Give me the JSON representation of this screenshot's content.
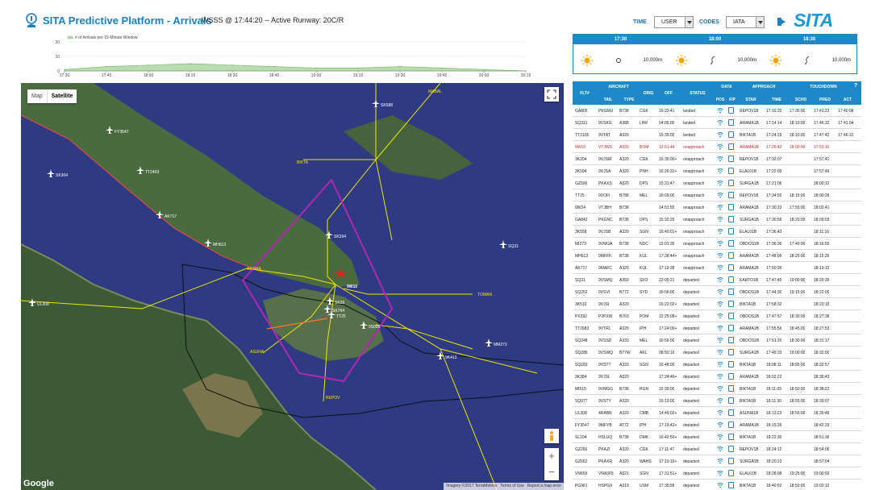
{
  "header": {
    "title": "SITA Predictive Platform - Arrivals",
    "subtitle": "WSSS @ 17:44:20 -- Active Runway: 20C/R",
    "time_label": "TIME",
    "time_value": "USER",
    "codes_label": "CODES",
    "codes_value": "IATA",
    "brand": "SITA"
  },
  "arrivals_chart": {
    "legend": "# of Arrivals per 15-Minute Window",
    "y_ticks": [
      "20",
      "10",
      "0"
    ],
    "x_ticks": [
      "17:30",
      "17:45",
      "18:00",
      "18:15",
      "18:30",
      "18:45",
      "19:00",
      "19:15",
      "19:30",
      "19:45",
      "20:00",
      "20:15"
    ]
  },
  "chart_data": {
    "type": "area",
    "title": "",
    "legend": [
      "# of Arrivals per 15-Minute Window"
    ],
    "x": [
      "17:30",
      "17:45",
      "18:00",
      "18:15",
      "18:30",
      "18:45",
      "19:00",
      "19:15",
      "19:30",
      "19:45",
      "20:00",
      "20:15"
    ],
    "series": [
      {
        "name": "# of Arrivals per 15-Minute Window",
        "values": [
          1,
          3,
          4,
          5,
          4,
          3,
          2,
          2,
          3,
          2,
          1,
          0
        ]
      }
    ],
    "ylim": [
      0,
      20
    ]
  },
  "map": {
    "tab_map": "Map",
    "tab_satellite": "Satellite",
    "attribution": [
      "Imagery ©2017 TerraMetrics",
      "Terms of Use",
      "Report a map error"
    ],
    "google": "Google",
    "fixes": [
      "MABAL",
      "BIKTA",
      "ARAMA",
      "ASUNA",
      "REPOV",
      "TOMAN"
    ],
    "airport": "9W10",
    "planes": [
      "SK588",
      "FY3547",
      "TT2403",
      "SK304",
      "AK717",
      "MH613",
      "SK394",
      "UL308",
      "TT25",
      "SK764",
      "9S056",
      "SQ31",
      "9K413",
      "MM273",
      "SK26"
    ],
    "wind_icons": [
      "sun-icon",
      "calm-icon",
      "windsock-icon"
    ],
    "colors": {
      "ocean": "#2e3a82",
      "land": "#3e5a3a",
      "route": "#f2e600",
      "terminal_area": "#b326b3",
      "border": "#111111"
    }
  },
  "weather": {
    "times": [
      "17:30",
      "18:00",
      "18:30"
    ],
    "visibility": [
      "10,000m",
      "10,000m",
      "10,000m"
    ]
  },
  "table": {
    "group_headers": {
      "aircraft": "AIRCRAFT",
      "data": "DATA",
      "approach": "APPROACH",
      "touchdown": "TOUCHDOWN"
    },
    "columns": [
      "FLT#",
      "TAIL",
      "TYPE",
      "ORIG",
      "OFF",
      "STATUS",
      "POS",
      "F/P",
      "STAR",
      "TIME",
      "SCHD",
      "PRED",
      "ACT"
    ],
    "help": "?",
    "rows": [
      {
        "flt": "GA805",
        "tail": "PKGMU",
        "type": "B738",
        "orig": "CGK",
        "off": "16:23:41",
        "status": "landed",
        "star": "REPOV1B",
        "time": "17:16:29",
        "schd": "17:35:00",
        "pred": "17:41:23",
        "act": "17:40:08"
      },
      {
        "flt": "SQ321",
        "tail": "9VSKG",
        "type": "A388",
        "orig": "LHR",
        "off": "04:05:00",
        "status": "landed",
        "star": "ARAMA1B",
        "time": "17:14:14",
        "schd": "18:10:00",
        "pred": "17:46:32",
        "act": "17:41:04"
      },
      {
        "flt": "TT2105",
        "tail": "9VTAT",
        "type": "A320",
        "orig": "",
        "off": "15:35:00",
        "status": "landed",
        "star": "BIKTA1B",
        "time": "17:24:19",
        "schd": "18:10:00",
        "pred": "17:47:42",
        "act": "17:46:10"
      },
      {
        "flt": "9W10",
        "tail": "VTJWS",
        "type": "A333",
        "orig": "BOM",
        "off": "12:51:44",
        "status": "onapproach",
        "star": "ARAMA1B",
        "time": "17:26:42",
        "schd": "18:00:00",
        "pred": "17:53:10",
        "act": "",
        "alert": true
      },
      {
        "flt": "3K204",
        "tail": "9VJSM",
        "type": "A320",
        "orig": "CGK",
        "off": "16:35:00+",
        "status": "onapproach",
        "star": "REPOV1B",
        "time": "17:32:07",
        "schd": "",
        "pred": "17:57:41",
        "act": ""
      },
      {
        "flt": "3K594",
        "tail": "9VJSA",
        "type": "A320",
        "orig": "PNH",
        "off": "16:26:31+",
        "status": "onapproach",
        "star": "ELAL01B",
        "time": "17:22:09",
        "schd": "",
        "pred": "17:57:49",
        "act": ""
      },
      {
        "flt": "GZ506",
        "tail": "PKAXS",
        "type": "A320",
        "orig": "DPS",
        "off": "15:31:47",
        "status": "onapproach",
        "star": "SURGA1B",
        "time": "17:21:06",
        "schd": "",
        "pred": "18:00:12",
        "act": ""
      },
      {
        "flt": "TT25",
        "tail": "9VOFI",
        "type": "B788",
        "orig": "MEL",
        "off": "10:09:00",
        "status": "onapproach",
        "star": "REPOV1B",
        "time": "17:34:50",
        "schd": "18:15:00",
        "pred": "18:00:28",
        "act": ""
      },
      {
        "flt": "9W24",
        "tail": "VTJBH",
        "type": "B738",
        "orig": "",
        "off": "14:01:55",
        "status": "onapproach",
        "star": "ARAMA1B",
        "time": "17:30:33",
        "schd": "17:55:00",
        "pred": "18:02:41",
        "act": ""
      },
      {
        "flt": "GA842",
        "tail": "PKGNC",
        "type": "B738",
        "orig": "DPS",
        "off": "15:32:29",
        "status": "onapproach",
        "star": "SURGA1B",
        "time": "17:30:56",
        "schd": "18:20:00",
        "pred": "18:09:03",
        "act": ""
      },
      {
        "flt": "3K558",
        "tail": "9VJSB",
        "type": "A320",
        "orig": "SGN",
        "off": "16:40:01+",
        "status": "onapproach",
        "star": "ELAL01B",
        "time": "17:36:43",
        "schd": "",
        "pred": "18:11:16",
        "act": ""
      },
      {
        "flt": "MI273",
        "tail": "9VMGA",
        "type": "B738",
        "orig": "NDC",
        "off": "15:01:35",
        "status": "onapproach",
        "star": "OBDOS1B",
        "time": "17:36:36",
        "schd": "17:40:00",
        "pred": "18:16:55",
        "act": ""
      },
      {
        "flt": "MH613",
        "tail": "9MFFF",
        "type": "B738",
        "orig": "KUL",
        "off": "17:28:44+",
        "status": "onapproach",
        "star": "ARAMA1B",
        "time": "17:48:09",
        "schd": "18:25:00",
        "pred": "18:15:26",
        "act": ""
      },
      {
        "flt": "AK717",
        "tail": "9MAFC",
        "type": "A320",
        "orig": "KUL",
        "off": "17:19:38",
        "status": "onapproach",
        "star": "ARAMA1B",
        "time": "17:50:36",
        "schd": "",
        "pred": "18:19:12",
        "act": ""
      },
      {
        "flt": "SQ31",
        "tail": "9VSMQ",
        "type": "A359",
        "orig": "SFO",
        "off": "23:05:21",
        "status": "departed",
        "star": "KARTO1B",
        "time": "17:47:45",
        "schd": "19:00:00",
        "pred": "18:20:39",
        "act": ""
      },
      {
        "flt": "SQ252",
        "tail": "9VSVI",
        "type": "B772",
        "orig": "SYD",
        "off": "10:56:00",
        "status": "departed",
        "star": "OBDOS1B",
        "time": "17:44:30",
        "schd": "19:15:00",
        "pred": "18:22:05",
        "act": ""
      },
      {
        "flt": "3K510",
        "tail": "9VJSI",
        "type": "A320",
        "orig": "",
        "off": "16:22:02+",
        "status": "departed",
        "star": "BIKTA1B",
        "time": "17:58:32",
        "schd": "",
        "pred": "18:23:15",
        "act": ""
      },
      {
        "flt": "PX392",
        "tail": "P2PXW",
        "type": "B763",
        "orig": "POM",
        "off": "12:25:08+",
        "status": "departed",
        "star": "OBDOS1B",
        "time": "17:47:57",
        "schd": "18:30:00",
        "pred": "18:27:38",
        "act": ""
      },
      {
        "flt": "TT2683",
        "tail": "9VTRL",
        "type": "A320",
        "orig": "IPH",
        "off": "17:24:00+",
        "status": "departed",
        "star": "ARAMA1B",
        "time": "17:55:56",
        "schd": "18:45:00",
        "pred": "18:27:53",
        "act": ""
      },
      {
        "flt": "SQ248",
        "tail": "9VSSD",
        "type": "A333",
        "orig": "MEL",
        "off": "10:56:00",
        "status": "departed",
        "star": "OBDOS1B",
        "time": "17:51:20",
        "schd": "18:30:00",
        "pred": "18:31:17",
        "act": ""
      },
      {
        "flt": "SQ286",
        "tail": "9VSWQ",
        "type": "B77W",
        "orig": "AKL",
        "off": "08:50:16",
        "status": "departed",
        "star": "SURGA1B",
        "time": "17:49:33",
        "schd": "19:00:00",
        "pred": "18:32:00",
        "act": ""
      },
      {
        "flt": "SQ183",
        "tail": "9VSTT",
        "type": "A333",
        "orig": "SGN",
        "off": "16:48:00",
        "status": "departed",
        "star": "BIKTA1B",
        "time": "18:08:11",
        "schd": "18:55:00",
        "pred": "18:32:57",
        "act": ""
      },
      {
        "flt": "3K384",
        "tail": "9VJSL",
        "type": "A320",
        "orig": "",
        "off": "17:24:46+",
        "status": "departed",
        "star": "ARAMA1B",
        "time": "18:02:22",
        "schd": "",
        "pred": "18:36:43",
        "act": ""
      },
      {
        "flt": "MI515",
        "tail": "9VMGG",
        "type": "B738",
        "orig": "RGN",
        "off": "15:39:00",
        "status": "departed",
        "star": "BIKTA1B",
        "time": "18:11:05",
        "schd": "18:50:00",
        "pred": "18:38:22",
        "act": ""
      },
      {
        "flt": "SQ977",
        "tail": "9VSTY",
        "type": "A333",
        "orig": "",
        "off": "16:19:00",
        "status": "departed",
        "star": "BIKTA1B",
        "time": "18:11:30",
        "schd": "18:55:00",
        "pred": "18:39:07",
        "act": ""
      },
      {
        "flt": "UL308",
        "tail": "4RABN",
        "type": "A320",
        "orig": "CMB",
        "off": "14:49:02+",
        "status": "departed",
        "star": "ASUNA1B",
        "time": "18:12:23",
        "schd": "18:55:00",
        "pred": "18:39:46",
        "act": ""
      },
      {
        "flt": "FY3547",
        "tail": "9MFYB",
        "type": "AT72",
        "orig": "IPH",
        "off": "17:19:43+",
        "status": "departed",
        "star": "ARAMA1B",
        "time": "18:15:26",
        "schd": "",
        "pred": "18:42:29",
        "act": ""
      },
      {
        "flt": "SL104",
        "tail": "HSLUQ",
        "type": "B738",
        "orig": "DMK",
        "off": "16:42:50+",
        "status": "departed",
        "star": "BIKTA1B",
        "time": "18:22:30",
        "schd": "",
        "pred": "18:51:36",
        "act": ""
      },
      {
        "flt": "GZ266",
        "tail": "PKAZI",
        "type": "A320",
        "orig": "CGK",
        "off": "17:11:47",
        "status": "departed",
        "star": "REPOV1B",
        "time": "18:24:12",
        "schd": "",
        "pred": "18:54:06",
        "act": ""
      },
      {
        "flt": "GZ662",
        "tail": "PKAXR",
        "type": "A320",
        "orig": "WAHS",
        "off": "17:19:19+",
        "status": "departed",
        "star": "SURGA1B",
        "time": "18:20:23",
        "schd": "",
        "pred": "18:57:04",
        "act": ""
      },
      {
        "flt": "VN659",
        "tail": "VNA365",
        "type": "A321",
        "orig": "SGN",
        "off": "17:31:51+",
        "status": "departed",
        "star": "ELAL01B",
        "time": "18:28:08",
        "schd": "19:25:00",
        "pred": "19:00:59",
        "act": ""
      },
      {
        "flt": "PG961",
        "tail": "HSPGX",
        "type": "A319",
        "orig": "USM",
        "off": "17:35:58",
        "status": "departed",
        "star": "BIKTA1B",
        "time": "18:40:52",
        "schd": "18:50:00",
        "pred": "19:02:10",
        "act": ""
      }
    ]
  }
}
